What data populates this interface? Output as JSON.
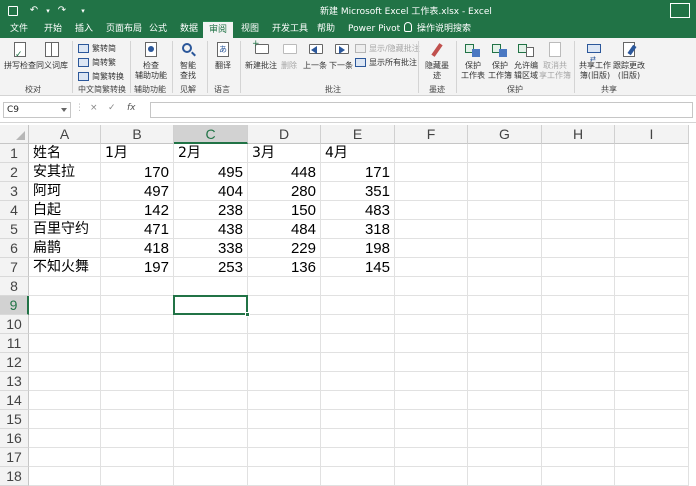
{
  "window": {
    "title": "新建 Microsoft Excel 工作表.xlsx  -  Excel",
    "quick_access": [
      "save-icon",
      "undo-icon",
      "redo-icon",
      "customize-icon"
    ]
  },
  "tabs": [
    "文件",
    "开始",
    "插入",
    "页面布局",
    "公式",
    "数据",
    "审阅",
    "视图",
    "开发工具",
    "帮助",
    "Power Pivot"
  ],
  "active_tab": "审阅",
  "tell_me": "操作说明搜索",
  "ribbon": {
    "proofing": {
      "spell": "拼写检查",
      "thesaurus": "同义词库",
      "group": "校对"
    },
    "chinese": {
      "to_trad": "繁转简",
      "to_simp": "简转繁",
      "convert": "简繁转换",
      "group": "中文简繁转换"
    },
    "access": {
      "check1": "检查",
      "check2": "辅助功能",
      "group": "辅助功能"
    },
    "insights": {
      "smart1": "智能",
      "smart2": "查找",
      "group": "见解"
    },
    "language": {
      "translate": "翻译",
      "group": "语言"
    },
    "comments": {
      "new": "新建批注",
      "delete": "删除",
      "prev": "上一条",
      "next": "下一条",
      "show_hide": "显示/隐藏批注",
      "show_all": "显示所有批注",
      "group": "批注"
    },
    "ink": {
      "hide1": "隐藏墨",
      "hide2": "迹",
      "group": "墨迹"
    },
    "protect": {
      "sheet1": "保护",
      "sheet2": "工作表",
      "book1": "保护",
      "book2": "工作簿",
      "range1": "允许编",
      "range2": "辑区域",
      "unshare1": "取消共",
      "unshare2": "享工作簿",
      "group": "保护"
    },
    "share": {
      "share1": "共享工作",
      "share2": "簿(旧版)",
      "track1": "跟踪更改",
      "track2": "(旧版)",
      "group": "共享"
    }
  },
  "formula_bar": {
    "name_box": "C9",
    "cancel": "×",
    "enter": "✓",
    "fx": "fx",
    "formula": ""
  },
  "sheet": {
    "columns": [
      "A",
      "B",
      "C",
      "D",
      "E",
      "F",
      "G",
      "H",
      "I"
    ],
    "rows": [
      "1",
      "2",
      "3",
      "4",
      "5",
      "6",
      "7",
      "8",
      "9",
      "10",
      "11",
      "12",
      "13",
      "14",
      "15",
      "16",
      "17",
      "18"
    ],
    "header_row": [
      "姓名",
      "1月",
      "2月",
      "3月",
      "4月"
    ],
    "data": [
      {
        "name": "安其拉",
        "values": [
          170,
          495,
          448,
          171
        ]
      },
      {
        "name": "阿珂",
        "values": [
          497,
          404,
          280,
          351
        ]
      },
      {
        "name": "白起",
        "values": [
          142,
          238,
          150,
          483
        ]
      },
      {
        "name": "百里守约",
        "values": [
          471,
          438,
          484,
          318
        ]
      },
      {
        "name": "扁鹊",
        "values": [
          418,
          338,
          229,
          198
        ]
      },
      {
        "name": "不知火舞",
        "values": [
          197,
          253,
          136,
          145
        ]
      }
    ],
    "comment_cells": [
      "C6",
      "D6"
    ],
    "selected_cell": "C9"
  },
  "colors": {
    "accent": "#217346",
    "ribbon_bg": "#f3f3f3",
    "comment_marker": "#c00000"
  }
}
